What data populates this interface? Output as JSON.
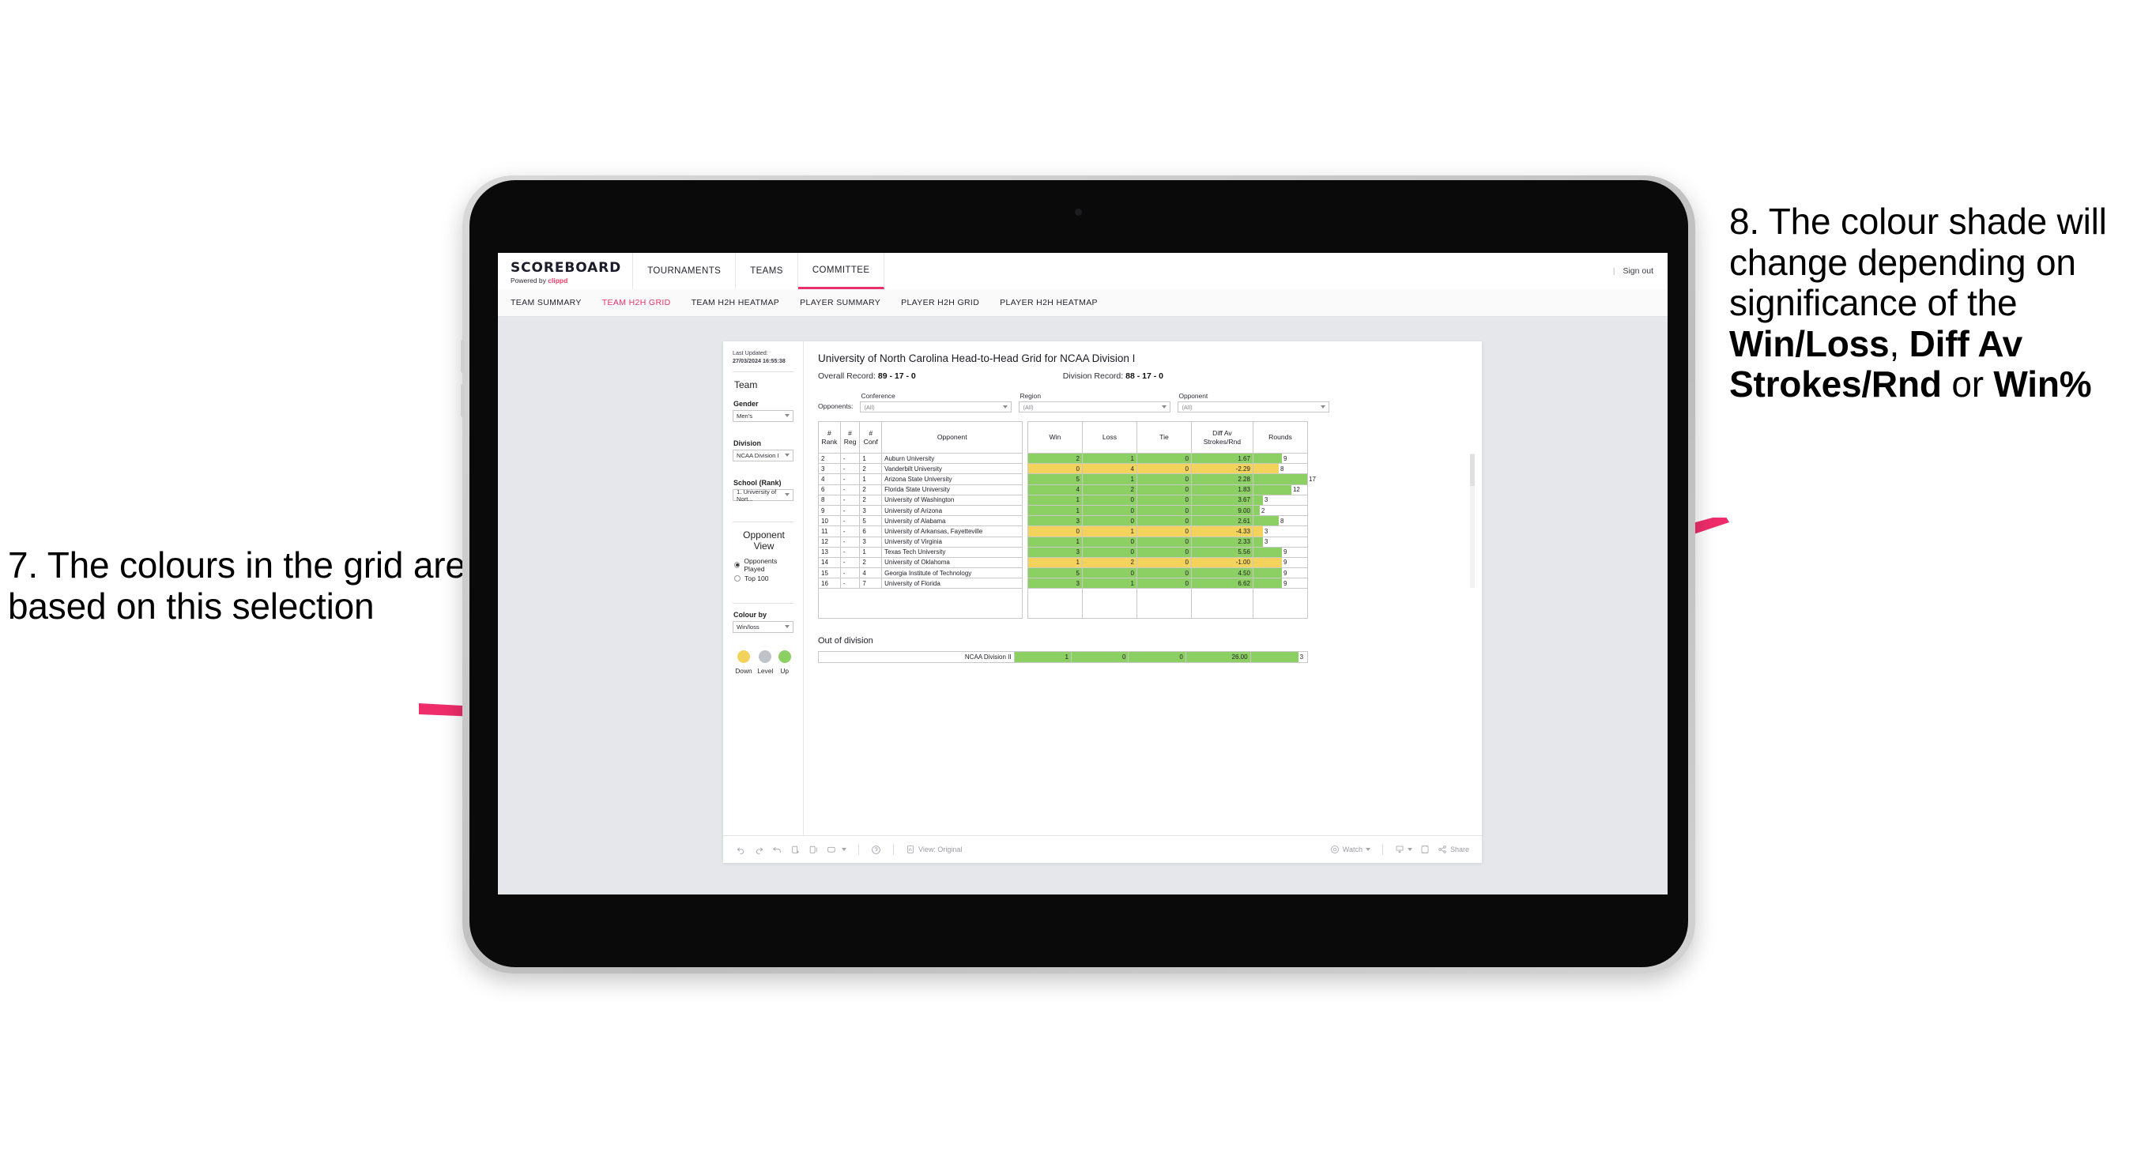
{
  "annotations": {
    "left": {
      "number": "7.",
      "text": "The colours in the grid are based on this selection"
    },
    "right": {
      "number": "8.",
      "lead": "The colour shade will change depending on significance of the ",
      "bold1": "Win/Loss",
      "mid1": ", ",
      "bold2": "Diff Av Strokes/Rnd",
      "mid2": " or ",
      "bold3": "Win%"
    },
    "arrow_color": "#ee2d6a"
  },
  "app": {
    "brand": {
      "title": "SCOREBOARD",
      "powered_prefix": "Powered by ",
      "powered_brand": "clippd"
    },
    "nav": [
      {
        "label": "TOURNAMENTS",
        "active": false
      },
      {
        "label": "TEAMS",
        "active": false
      },
      {
        "label": "COMMITTEE",
        "active": true
      }
    ],
    "sign_out": "Sign out",
    "subnav": [
      {
        "label": "TEAM SUMMARY",
        "active": false
      },
      {
        "label": "TEAM H2H GRID",
        "active": true
      },
      {
        "label": "TEAM H2H HEATMAP",
        "active": false
      },
      {
        "label": "PLAYER SUMMARY",
        "active": false
      },
      {
        "label": "PLAYER H2H GRID",
        "active": false
      },
      {
        "label": "PLAYER H2H HEATMAP",
        "active": false
      }
    ]
  },
  "sidebar": {
    "last_updated_label": "Last Updated: ",
    "last_updated_value": "27/03/2024 16:55:38",
    "team_heading": "Team",
    "gender_label": "Gender",
    "gender_value": "Men's",
    "division_label": "Division",
    "division_value": "NCAA Division I",
    "school_label": "School (Rank)",
    "school_value": "1. University of Nort...",
    "opponent_view_heading": "Opponent View",
    "radio_opponents_played": "Opponents Played",
    "radio_top100": "Top 100",
    "colour_by_label": "Colour by",
    "colour_by_value": "Win/loss",
    "legend": [
      {
        "label": "Down",
        "color": "#f3d35c"
      },
      {
        "label": "Level",
        "color": "#bfc2c7"
      },
      {
        "label": "Up",
        "color": "#8ccf63"
      }
    ]
  },
  "main": {
    "title": "University of North Carolina Head-to-Head Grid for NCAA Division I",
    "overall_record_label": "Overall Record: ",
    "overall_record_value": "89 - 17 - 0",
    "division_record_label": "Division Record: ",
    "division_record_value": "88 - 17 - 0",
    "opponents_label": "Opponents:",
    "filters": [
      {
        "label": "Conference",
        "value": "(All)"
      },
      {
        "label": "Region",
        "value": "(All)"
      },
      {
        "label": "Opponent",
        "value": "(All)"
      }
    ],
    "out_of_division_title": "Out of division"
  },
  "chart_data": {
    "type": "table",
    "title": "University of North Carolina Head-to-Head Grid for NCAA Division I",
    "columns": [
      "# Rank",
      "# Reg",
      "# Conf",
      "Opponent",
      "Win",
      "Loss",
      "Tie",
      "Diff Av Strokes/Rnd",
      "Rounds"
    ],
    "colour_by": "Win/loss",
    "colour_scale": {
      "down": "#f3d35c",
      "level": "#bfc2c7",
      "up": "#8ccf63"
    },
    "rounds_max": 17,
    "rows": [
      {
        "rank": "2",
        "reg": "-",
        "conf": "1",
        "opponent": "Auburn University",
        "win": "2",
        "loss": "1",
        "tie": "0",
        "diff": "1.67",
        "rounds": "9",
        "state": "up"
      },
      {
        "rank": "3",
        "reg": "-",
        "conf": "2",
        "opponent": "Vanderbilt University",
        "win": "0",
        "loss": "4",
        "tie": "0",
        "diff": "-2.29",
        "rounds": "8",
        "state": "down"
      },
      {
        "rank": "4",
        "reg": "-",
        "conf": "1",
        "opponent": "Arizona State University",
        "win": "5",
        "loss": "1",
        "tie": "0",
        "diff": "2.28",
        "rounds": "17",
        "state": "up"
      },
      {
        "rank": "6",
        "reg": "-",
        "conf": "2",
        "opponent": "Florida State University",
        "win": "4",
        "loss": "2",
        "tie": "0",
        "diff": "1.83",
        "rounds": "12",
        "state": "up"
      },
      {
        "rank": "8",
        "reg": "-",
        "conf": "2",
        "opponent": "University of Washington",
        "win": "1",
        "loss": "0",
        "tie": "0",
        "diff": "3.67",
        "rounds": "3",
        "state": "up"
      },
      {
        "rank": "9",
        "reg": "-",
        "conf": "3",
        "opponent": "University of Arizona",
        "win": "1",
        "loss": "0",
        "tie": "0",
        "diff": "9.00",
        "rounds": "2",
        "state": "up"
      },
      {
        "rank": "10",
        "reg": "-",
        "conf": "5",
        "opponent": "University of Alabama",
        "win": "3",
        "loss": "0",
        "tie": "0",
        "diff": "2.61",
        "rounds": "8",
        "state": "up"
      },
      {
        "rank": "11",
        "reg": "-",
        "conf": "6",
        "opponent": "University of Arkansas, Fayetteville",
        "win": "0",
        "loss": "1",
        "tie": "0",
        "diff": "-4.33",
        "rounds": "3",
        "state": "down"
      },
      {
        "rank": "12",
        "reg": "-",
        "conf": "3",
        "opponent": "University of Virginia",
        "win": "1",
        "loss": "0",
        "tie": "0",
        "diff": "2.33",
        "rounds": "3",
        "state": "up"
      },
      {
        "rank": "13",
        "reg": "-",
        "conf": "1",
        "opponent": "Texas Tech University",
        "win": "3",
        "loss": "0",
        "tie": "0",
        "diff": "5.56",
        "rounds": "9",
        "state": "up"
      },
      {
        "rank": "14",
        "reg": "-",
        "conf": "2",
        "opponent": "University of Oklahoma",
        "win": "1",
        "loss": "2",
        "tie": "0",
        "diff": "-1.00",
        "rounds": "9",
        "state": "down"
      },
      {
        "rank": "15",
        "reg": "-",
        "conf": "4",
        "opponent": "Georgia Institute of Technology",
        "win": "5",
        "loss": "0",
        "tie": "0",
        "diff": "4.50",
        "rounds": "9",
        "state": "up"
      },
      {
        "rank": "16",
        "reg": "-",
        "conf": "7",
        "opponent": "University of Florida",
        "win": "3",
        "loss": "1",
        "tie": "0",
        "diff": "6.62",
        "rounds": "9",
        "state": "up"
      }
    ],
    "out_of_division": [
      {
        "opponent": "NCAA Division II",
        "win": "1",
        "loss": "0",
        "tie": "0",
        "diff": "26.00",
        "rounds": "3",
        "state": "up"
      }
    ]
  },
  "toolbar": {
    "view_label": "View: Original",
    "watch_label": "Watch",
    "share_label": "Share"
  }
}
